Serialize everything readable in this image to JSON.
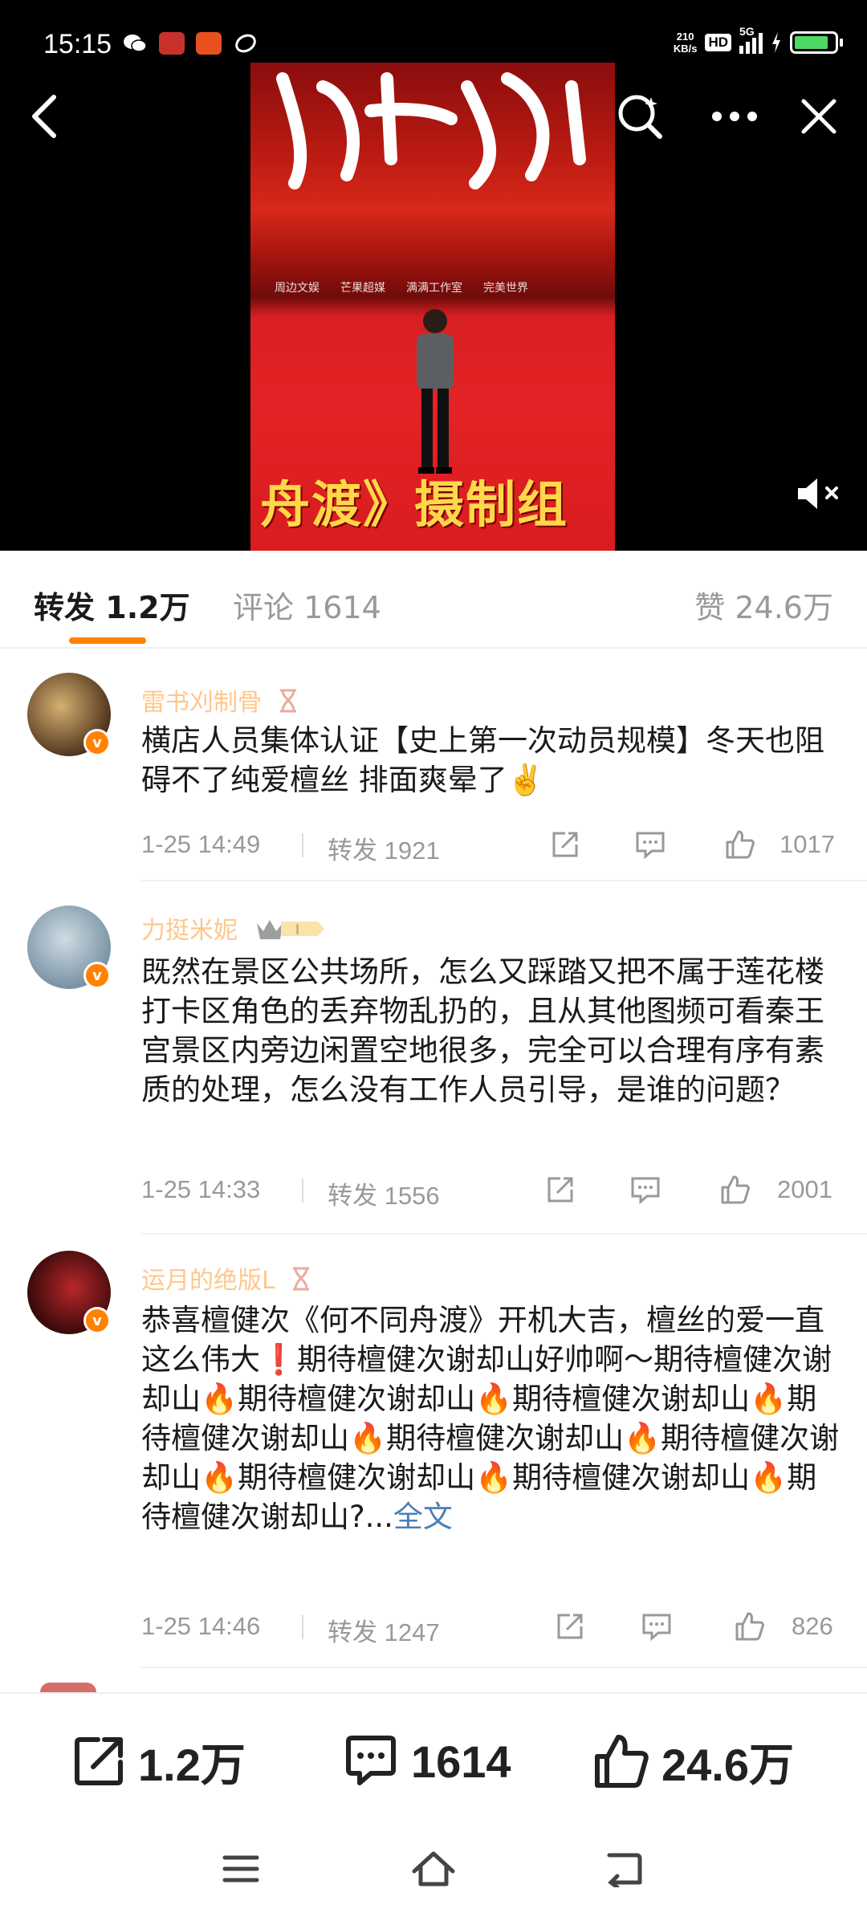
{
  "status_bar": {
    "time": "15:15",
    "net_speed_value": "210",
    "net_speed_unit": "KB/s",
    "hd": "HD",
    "network": "5G"
  },
  "video": {
    "caption": "舟渡》摄制组",
    "logos": [
      "周边文娱",
      "芒果超媒",
      "满满工作室",
      "完美世界"
    ]
  },
  "tabs": {
    "repost_label": "转发",
    "repost_count": "1.2万",
    "comment_label": "评论",
    "comment_count": "1614",
    "like_label": "赞",
    "like_count": "24.6万"
  },
  "reposts": [
    {
      "username": "雷书刈制骨",
      "text": "横店人员集体认证【史上第一次动员规模】冬天也阻碍不了纯爱檀丝 排面爽晕了✌️",
      "date": "1-25 14:49",
      "repost_label": "转发 1921",
      "likes": "1017"
    },
    {
      "username": "力挺米妮",
      "badge": "I",
      "text": "既然在景区公共场所，怎么又踩踏又把不属于莲花楼打卡区角色的丢弃物乱扔的，且从其他图频可看秦王宫景区内旁边闲置空地很多，完全可以合理有序有素质的处理，怎么没有工作人员引导，是谁的问题？",
      "date": "1-25 14:33",
      "repost_label": "转发 1556",
      "likes": "2001"
    },
    {
      "username": "运月的绝版L",
      "text": "恭喜檀健次《何不同舟渡》开机大吉，檀丝的爱一直这么伟大❗期待檀健次谢却山好帅啊～期待檀健次谢却山🔥期待檀健次谢却山🔥期待檀健次谢却山🔥期待檀健次谢却山🔥期待檀健次谢却山🔥期待檀健次谢却山🔥期待檀健次谢却山🔥期待檀健次谢却山🔥期待檀健次谢却山?...",
      "more": "全文",
      "date": "1-25 14:46",
      "repost_label": "转发 1247",
      "likes": "826"
    }
  ],
  "action_bar": {
    "repost_count": "1.2万",
    "comment_count": "1614",
    "like_count": "24.6万"
  },
  "colors": {
    "accent": "#ff8200",
    "link": "#4a7fb5",
    "muted": "#999999"
  }
}
